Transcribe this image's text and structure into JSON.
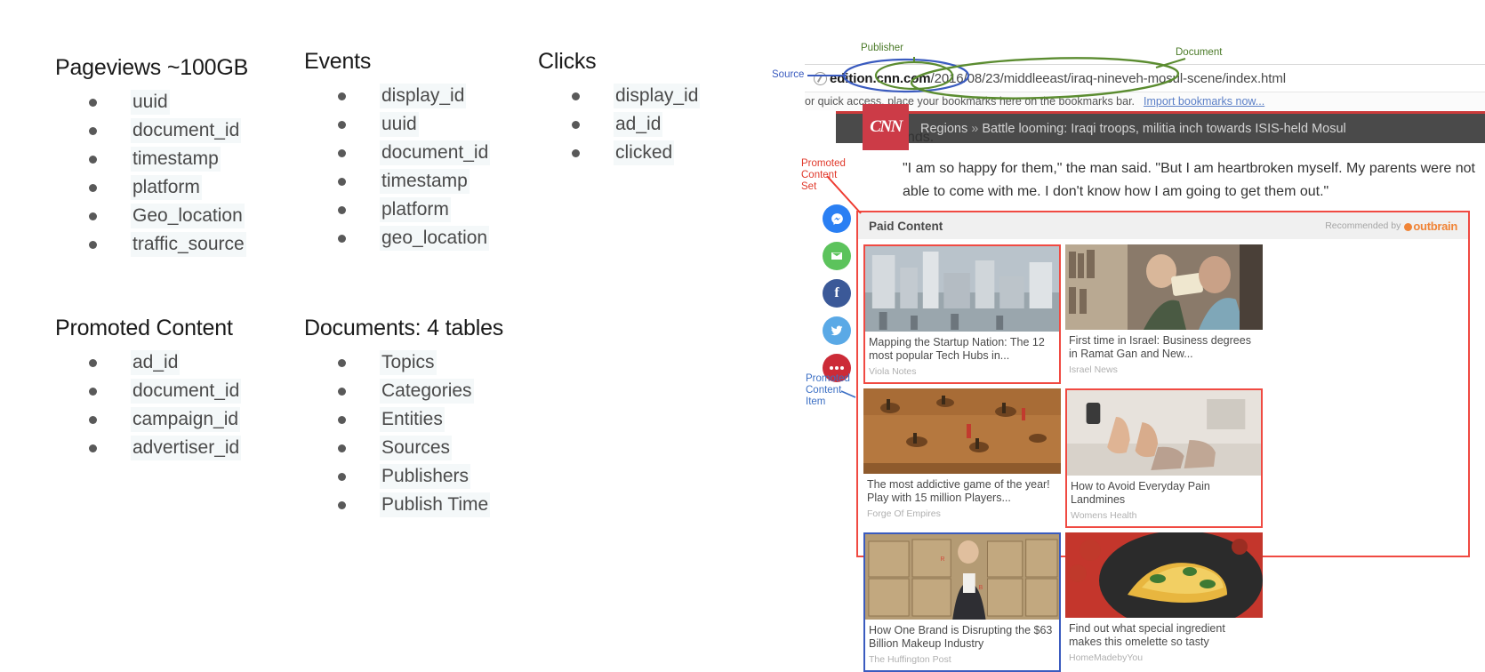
{
  "schema": {
    "blocks": [
      {
        "id": "pageviews",
        "title": "Pageviews ~100GB",
        "fields": [
          "uuid",
          "document_id",
          "timestamp",
          "platform",
          "Geo_location",
          "traffic_source"
        ]
      },
      {
        "id": "events",
        "title": "Events",
        "fields": [
          "display_id",
          "uuid",
          "document_id",
          "timestamp",
          "platform",
          "geo_location"
        ]
      },
      {
        "id": "clicks",
        "title": "Clicks",
        "fields": [
          "display_id",
          "ad_id",
          "clicked"
        ]
      },
      {
        "id": "promoted-content",
        "title": "Promoted Content",
        "fields": [
          "ad_id",
          "document_id",
          "campaign_id",
          "advertiser_id"
        ]
      },
      {
        "id": "documents",
        "title": "Documents: 4 tables",
        "fields": [
          "Topics",
          "Categories",
          "Entities",
          "Sources",
          "Publishers",
          "Publish Time"
        ]
      }
    ]
  },
  "browser": {
    "url": {
      "source_part": "edition.",
      "publisher_part": "cnn.com",
      "path_part": "/2016/08/23/middleeast/iraq-nineveh-mosul-scene/index.html"
    },
    "bookmark_bar": {
      "text": "or quick access, place your bookmarks here on the bookmarks bar.",
      "link": "Import bookmarks now..."
    },
    "cnn": {
      "logo": "CNN",
      "breadcrumb_section": "Regions",
      "breadcrumb_sep": "»",
      "headline": "Battle looming: Iraqi troops, militia inch towards ISIS-held Mosul",
      "trailing_text": "nds."
    },
    "article_paragraph": "\"I am so happy for them,\" the man said. \"But I am heartbroken myself. My parents were not able to come with me. I don't know how I am going to get them out.\"",
    "social_icons": [
      {
        "name": "messenger-icon",
        "glyph": "⚡"
      },
      {
        "name": "email-icon",
        "glyph": "✉"
      },
      {
        "name": "facebook-icon",
        "glyph": "f"
      },
      {
        "name": "twitter-icon",
        "glyph": "🐦"
      },
      {
        "name": "more-icon",
        "glyph": "•••"
      }
    ]
  },
  "annotations": [
    {
      "id": "source",
      "label": "Source",
      "color": "#3a5bbf"
    },
    {
      "id": "publisher",
      "label": "Publisher",
      "color": "#4b7a28"
    },
    {
      "id": "document",
      "label": "Document",
      "color": "#4b7a28"
    },
    {
      "id": "promoted-content-set",
      "label": "Promoted\nContent\nSet",
      "color": "#e0392b"
    },
    {
      "id": "promoted-content-item",
      "label": "Promoted\nContent\nItem",
      "color": "#3b6fc4"
    }
  ],
  "paid_content": {
    "header_title": "Paid Content",
    "recommended_prefix": "Recommended by",
    "recommended_brand": "outbrain",
    "cards": [
      {
        "title": "Mapping the Startup Nation: The 12 most popular Tech Hubs in...",
        "source": "Viola Notes",
        "highlight": "none",
        "thumb": "city-skyline"
      },
      {
        "title": "First time in Israel: Business degrees in Ramat Gan and New...",
        "source": "Israel News",
        "highlight": "none",
        "thumb": "library-students"
      },
      {
        "title": "The most addictive game of the year! Play with 15 million Players...",
        "source": "Forge Of Empires",
        "highlight": "none",
        "thumb": "battle-game"
      },
      {
        "title": "How to Avoid Everyday Pain Landmines",
        "source": "Womens Health",
        "highlight": "none",
        "thumb": "feet-heels"
      },
      {
        "title": "How One Brand is Disrupting the $63 Billion Makeup Industry",
        "source": "The Huffington Post",
        "highlight": "blue",
        "thumb": "man-boxes"
      },
      {
        "title": "Find out what special ingredient makes this omelette so tasty",
        "source": "HomeMadebyYou",
        "highlight": "none",
        "thumb": "omelette-food"
      }
    ]
  }
}
